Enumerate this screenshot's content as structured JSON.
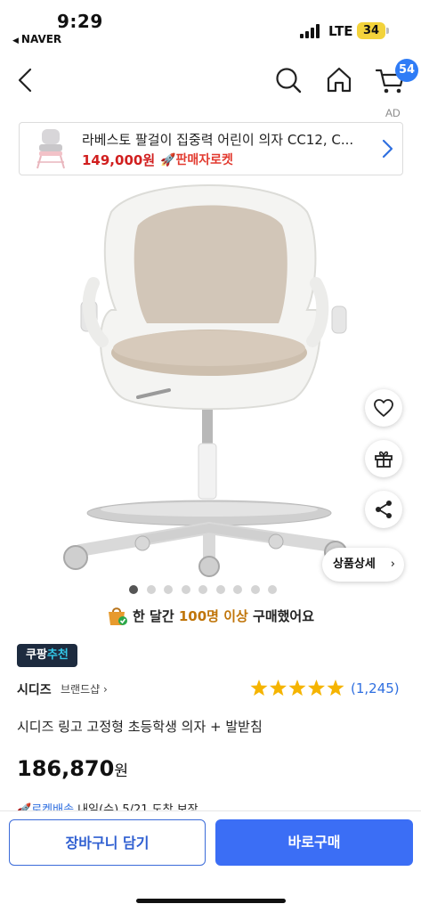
{
  "status_bar": {
    "time": "9:29",
    "back_app": "NAVER",
    "network": "LTE",
    "battery": "34"
  },
  "nav": {
    "back_icon": "chevron-left-icon",
    "search_icon": "search-icon",
    "home_icon": "home-icon",
    "cart_icon": "cart-icon",
    "cart_count": "54"
  },
  "ad": {
    "label": "AD",
    "title": "라베스토 팔걸이 집중력 어린이 의자 CC12, C...",
    "price": "149,000원",
    "rocket_label": "판매자로켓"
  },
  "gallery": {
    "total_images": 9,
    "active_index": 0
  },
  "side_actions": {
    "wishlist_icon": "heart-icon",
    "gift_icon": "gift-icon",
    "share_icon": "share-icon",
    "detail_label": "상품상세"
  },
  "sales": {
    "prefix": "한 달간 ",
    "highlight": "100명 이상",
    "suffix": " 구매했어요"
  },
  "badge": {
    "coupang": "쿠팡",
    "recommend": "추천"
  },
  "product": {
    "brand": "시디즈",
    "brand_shop": "브랜드샵",
    "rating_stars": 5,
    "review_count": "(1,245)",
    "name": "시디즈 링고 고정형 초등학생 의자 + 발받침",
    "price": "186,870",
    "price_unit": "원"
  },
  "delivery": {
    "label": "로켓배송",
    "date_text": " 내일(수) 5/21 도착 보장"
  },
  "bottom": {
    "cart_button": "장바구니 담기",
    "buy_button": "바로구매"
  },
  "colors": {
    "accent_blue": "#3b6ef5",
    "price_red": "#d11f1f",
    "star_yellow": "#f5b400",
    "review_blue": "#2f6fe0",
    "badge_dark": "#1d2b3f"
  }
}
